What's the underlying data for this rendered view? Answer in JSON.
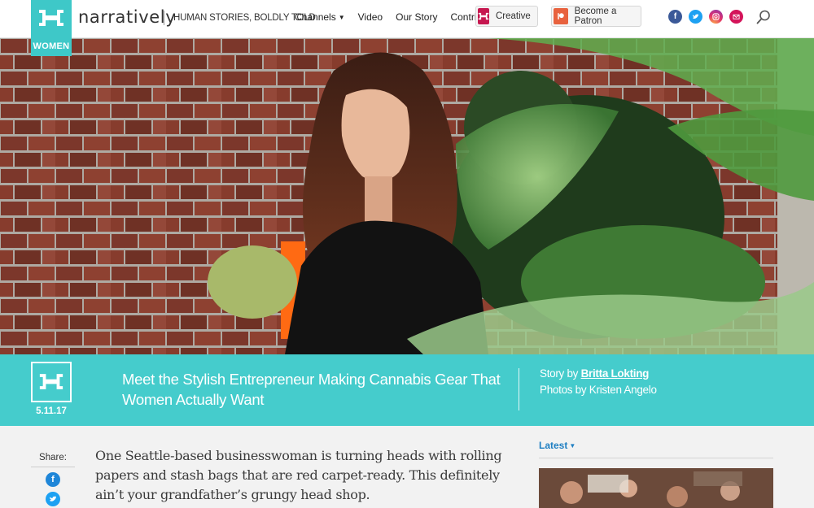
{
  "header": {
    "brand": "narratively",
    "logo_tag": "WOMEN",
    "tagline": "HUMAN STORIES, BOLDLY TOLD",
    "nav": [
      {
        "label": "Channels",
        "has_caret": true
      },
      {
        "label": "Video"
      },
      {
        "label": "Our Story"
      },
      {
        "label": "Contribute"
      }
    ],
    "creative_label": "Creative",
    "patron_label": "Become a Patron",
    "social": [
      "facebook-icon",
      "twitter-icon",
      "instagram-icon",
      "email-icon"
    ]
  },
  "hero": {
    "date": "5.11.17",
    "headline": "Meet the Stylish Entrepreneur Making Cannabis Gear That Women Actually Want",
    "story_by_label": "Story by",
    "author": "Britta Lokting",
    "photos_by": "Photos by Kristen Angelo"
  },
  "article": {
    "share_label": "Share:",
    "intro": "One Seattle-based businesswoman is turning heads with rolling papers and stash bags that are red carpet-ready. This definitely ain’t your grandfather’s grungy head shop."
  },
  "sidebar": {
    "latest_label": "Latest"
  },
  "colors": {
    "teal": "#3ec8c8",
    "creative": "#c6174f",
    "patreon": "#e8623e",
    "link": "#1f7fc2"
  }
}
